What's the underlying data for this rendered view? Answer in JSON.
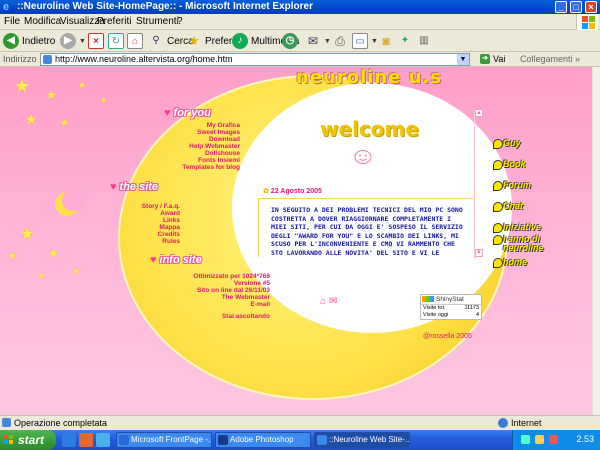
{
  "window": {
    "title": "::Neuroline Web Site-HomePage:: - Microsoft Internet Explorer"
  },
  "menu": [
    "File",
    "Modifica",
    "Visualizza",
    "Preferiti",
    "Strumenti",
    "?"
  ],
  "toolbar": {
    "back_label": "Indietro",
    "search_label": "Cerca",
    "favorites_label": "Preferiti",
    "media_label": "Multimedia"
  },
  "address": {
    "label": "Indirizzo",
    "url": "http://www.neuroline.altervista.org/home.htm",
    "go_label": "Vai",
    "links_label": "Collegamenti"
  },
  "page": {
    "logo": "neuroline u.s",
    "welcome": "welcome",
    "sections": {
      "for_you": "for you",
      "the_site": "the site",
      "info_site": "info site"
    },
    "for_you_links": [
      "My Grafica",
      "Sweet Images",
      "Download",
      "Help Webmaster",
      "Dollshouse",
      "Fonts Insiemi",
      "Templates for blog"
    ],
    "site_links": [
      "Story / F.a.q.",
      "Award",
      "Links",
      "Mappa",
      "Credits",
      "Rules"
    ],
    "info_lines": [
      "Ottimizzato per 1024*768",
      "Versione #5",
      "Sito on line dal 26/11/03",
      "The Webmaster",
      "E-mail",
      "Stai ascoltando"
    ],
    "news_date": "22 Agosto 2005",
    "news_text": "IN SEGUITO A DEI PROBLEMI TECNICI DEL MIO PC SONO COSTRETTA A DOVER RIAGGIORNARE COMPLETAMENTE I MIEI SITI, PER CUI DA OGGI E' SOSPESO IL SERVIZIO DEGLI \"AWARD FOR YOU\" E LO SCAMBIO DEI LINKS, MI SCUSO PER L'INCONVENIENTE E CMQ VI RAMMENTO CHE STO LAVORANDO ALLE NOVITA' DEL SITO E VI LE",
    "right_nav": [
      "Guy",
      "Book",
      "Forum",
      "Chat",
      "Iniziative",
      "I anno di neuroline",
      "home"
    ],
    "counter": {
      "brand": "ShinyStat",
      "total_label": "Visite tot.",
      "total_value": "11173",
      "today_label": "Visite oggi",
      "today_value": "4"
    },
    "copyright": "@rossella 2005"
  },
  "status": {
    "message": "Operazione completata",
    "zone": "Internet"
  },
  "taskbar": {
    "start": "start",
    "items": [
      "Microsoft FrontPage -...",
      "Adobe Photoshop",
      "::Neuroline Web Site-..."
    ],
    "clock": "2.53"
  },
  "colors": {
    "page_pink": "#ffb3d6",
    "moon_yellow": "#ffe24a",
    "link_pink": "#e0196f",
    "news_blue": "#1414a0",
    "xp_blue": "#0046c8"
  }
}
